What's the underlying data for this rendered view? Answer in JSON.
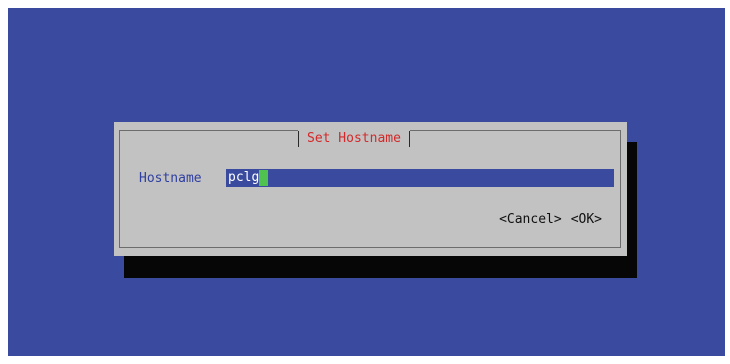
{
  "colors": {
    "screen_bg": "#3a4a9e",
    "dialog_bg": "#c2c2c2",
    "title_color": "#d3292a",
    "label_color": "#2f3fa0",
    "cursor_color": "#4fc24f",
    "shadow": "#060606"
  },
  "dialog": {
    "title": "Set Hostname",
    "field_label": "Hostname",
    "field_value": "pclg",
    "cancel_label": "<Cancel>",
    "ok_label": "<OK>"
  }
}
